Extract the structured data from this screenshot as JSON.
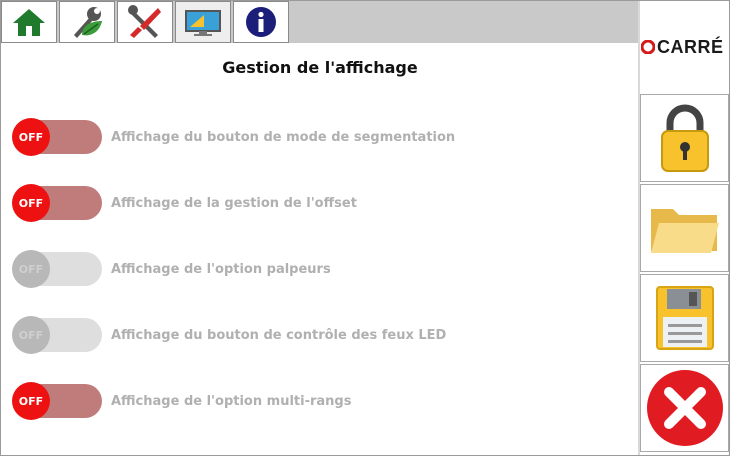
{
  "tabs": [
    {
      "name": "home",
      "icon": "home-icon",
      "active": false
    },
    {
      "name": "settings",
      "icon": "wrench-leaf-icon",
      "active": false
    },
    {
      "name": "tools",
      "icon": "wrench-screwdriver-icon",
      "active": false
    },
    {
      "name": "display",
      "icon": "monitor-icon",
      "active": true
    },
    {
      "name": "info",
      "icon": "info-icon",
      "active": false
    }
  ],
  "brand": {
    "name": "CARRÉ",
    "color": "#d31a1a"
  },
  "page": {
    "title": "Gestion de l'affichage"
  },
  "options": [
    {
      "label": "Affichage du bouton de mode de segmentation",
      "state": "OFF",
      "enabled": true
    },
    {
      "label": "Affichage de la gestion de l'offset",
      "state": "OFF",
      "enabled": true
    },
    {
      "label": "Affichage de l'option palpeurs",
      "state": "OFF",
      "enabled": false
    },
    {
      "label": "Affichage du bouton de contrôle des feux LED",
      "state": "OFF",
      "enabled": false
    },
    {
      "label": "Affichage de l'option multi-rangs",
      "state": "OFF",
      "enabled": true
    }
  ],
  "side_buttons": [
    {
      "name": "lock",
      "icon": "padlock-icon"
    },
    {
      "name": "open",
      "icon": "folder-icon"
    },
    {
      "name": "save",
      "icon": "floppy-disk-icon"
    },
    {
      "name": "close",
      "icon": "close-icon"
    }
  ],
  "colors": {
    "toggle_on_knob": "#ee1111",
    "toggle_track": "#c07b7b",
    "disabled": "#b8b8b8",
    "accent_yellow": "#f7c22b"
  }
}
